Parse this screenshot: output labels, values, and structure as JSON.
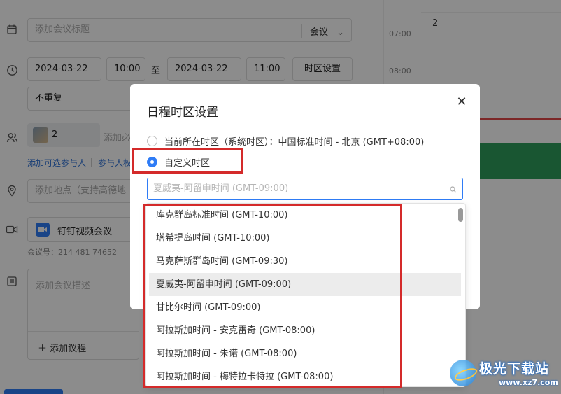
{
  "editor": {
    "title_placeholder": "添加会议标题",
    "type_select": "会议",
    "start_date": "2024-03-22",
    "start_time": "10:00",
    "to_label": "至",
    "end_date": "2024-03-22",
    "end_time": "11:00",
    "timezone_button": "时区设置",
    "repeat": "不重复",
    "participant_count": "2",
    "participant_placeholder": "添加必",
    "add_optional_link": "添加可选参与人",
    "participant_perm_link": "参与人权",
    "location_placeholder": "添加地点（支持高德地",
    "video_label": "钉钉视频会议",
    "meeting_number": "会议号：214 481 74652",
    "description_placeholder": "添加会议描述",
    "add_agenda": "添加议程"
  },
  "calendar": {
    "day": "2",
    "times": [
      "07:00",
      "08:00"
    ]
  },
  "dialog": {
    "title": "日程时区设置",
    "close": "✕",
    "option_system": "当前所在时区（系统时区）：中国标准时间 - 北京 (GMT+08:00)",
    "option_custom": "自定义时区",
    "selected_value": "夏威夷-阿留申时间 (GMT-09:00)"
  },
  "dropdown": {
    "items": [
      "库克群岛标准时间 (GMT-10:00)",
      "塔希提岛时间 (GMT-10:00)",
      "马克萨斯群岛时间 (GMT-09:30)",
      "夏威夷-阿留申时间 (GMT-09:00)",
      "甘比尔时间 (GMT-09:00)",
      "阿拉斯加时间 - 安克雷奇 (GMT-08:00)",
      "阿拉斯加时间 - 朱诺 (GMT-08:00)",
      "阿拉斯加时间 - 梅特拉卡特拉 (GMT-08:00)"
    ],
    "highlighted_index": 3
  },
  "watermark": {
    "text": "极光下载站",
    "url": "www.xz7.com"
  },
  "colors": {
    "accent": "#2f7cf6",
    "annotation_red": "#d42a2a",
    "calendar_green": "#2e9d5b"
  }
}
